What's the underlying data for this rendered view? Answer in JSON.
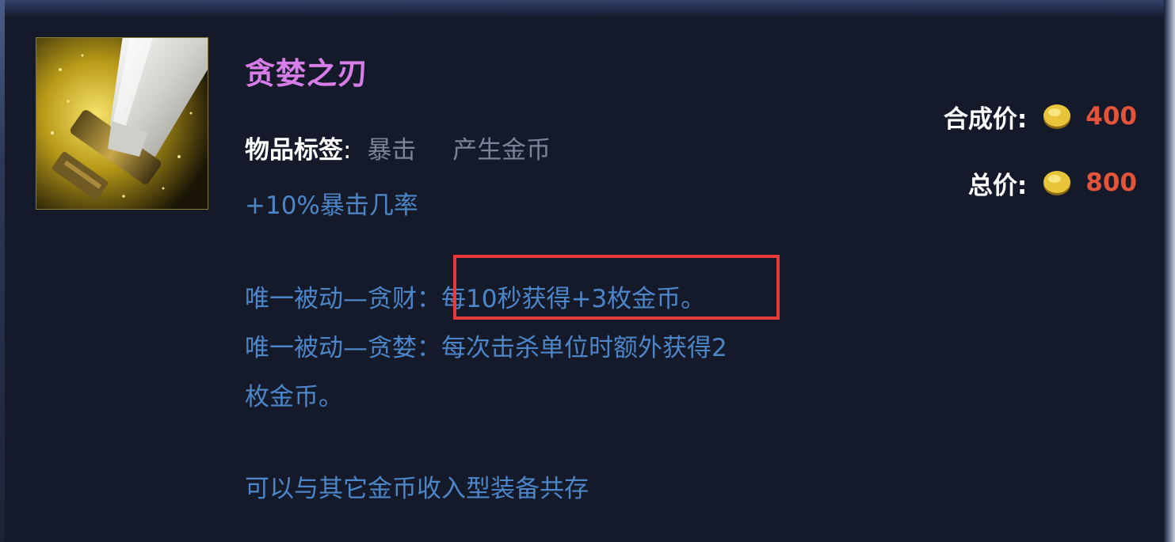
{
  "item": {
    "name": "贪婪之刃",
    "icon": "sword-hilt-icon"
  },
  "tags": {
    "label": "物品标签",
    "colon": ":",
    "items": [
      "暴击",
      "产生金币"
    ]
  },
  "stats": {
    "line1": "+10%暴击几率"
  },
  "passives": {
    "line1_prefix": "唯一被动—贪财：",
    "line1_highlight": "每10秒获得+3枚金币。",
    "line2": "唯一被动—贪婪：每次击杀单位时额外获得2",
    "line3": "枚金币。"
  },
  "footer": {
    "note": "可以与其它金币收入型装备共存"
  },
  "prices": {
    "combine_label": "合成价:",
    "combine_value": "400",
    "total_label": "总价:",
    "total_value": "800",
    "coin_icon": "gold-coin-icon"
  },
  "colors": {
    "name": "#d77de8",
    "description": "#4d86c8",
    "price": "#e2553a",
    "highlight_border": "#e83a3a",
    "background": "#151a2b"
  }
}
